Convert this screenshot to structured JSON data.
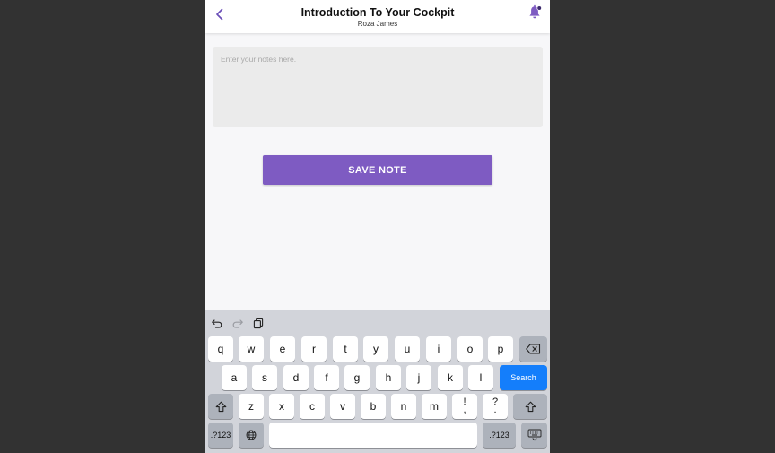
{
  "header": {
    "title": "Introduction To Your Cockpit",
    "subtitle": "Roza James"
  },
  "notes": {
    "value": "",
    "placeholder": "Enter your notes here."
  },
  "save_button": {
    "label": "SAVE NOTE"
  },
  "colors": {
    "accent": "#7e5bc2",
    "keyboard_bg": "#d2d4da",
    "search_key": "#147efb"
  },
  "keyboard": {
    "row1": [
      "q",
      "w",
      "e",
      "r",
      "t",
      "y",
      "u",
      "i",
      "o",
      "p"
    ],
    "row2": [
      "a",
      "s",
      "d",
      "f",
      "g",
      "h",
      "j",
      "k",
      "l"
    ],
    "row3": [
      "z",
      "x",
      "c",
      "v",
      "b",
      "n",
      "m"
    ],
    "punct1": [
      "!",
      ","
    ],
    "punct2": [
      "?",
      "."
    ],
    "search_label": "Search",
    "numbers_label": ".?123",
    "numbers_label_right": ".?123"
  },
  "icons": {
    "back": "chevron-left-icon",
    "bell": "bell-icon",
    "undo": "undo-icon",
    "redo": "redo-icon",
    "paste": "paste-icon",
    "backspace": "backspace-icon",
    "shift": "shift-icon",
    "globe": "globe-icon",
    "keyboard_hide": "keyboard-hide-icon"
  }
}
